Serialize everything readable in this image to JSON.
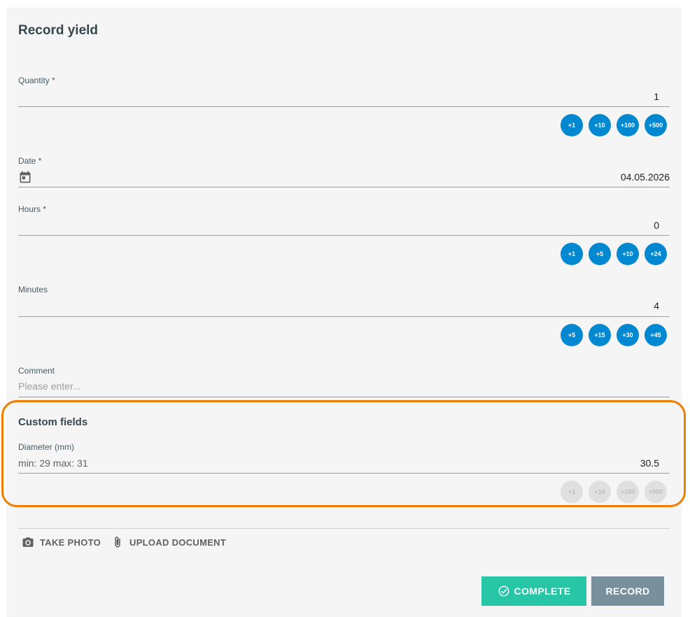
{
  "title": "Record yield",
  "quantity": {
    "label": "Quantity *",
    "value": "1",
    "buttons": [
      "+1",
      "+10",
      "+100",
      "+500"
    ]
  },
  "date": {
    "label": "Date *",
    "value": "04.05.2026",
    "icon": "calendar-icon"
  },
  "hours": {
    "label": "Hours *",
    "value": "0",
    "buttons": [
      "+1",
      "+5",
      "+10",
      "+24"
    ]
  },
  "minutes": {
    "label": "Minutes",
    "value": "4",
    "buttons": [
      "+5",
      "+15",
      "+30",
      "+45"
    ]
  },
  "comment": {
    "label": "Comment",
    "placeholder": "Please enter..."
  },
  "custom_fields": {
    "title": "Custom fields",
    "diameter": {
      "label": "Diameter (mm)",
      "hint": "min: 29 max: 31",
      "value": "30.5",
      "buttons": [
        "+1",
        "+10",
        "+100",
        "+500"
      ]
    }
  },
  "actions": {
    "take_photo": "TAKE PHOTO",
    "upload_document": "UPLOAD DOCUMENT",
    "complete": "COMPLETE",
    "record": "RECORD"
  },
  "colors": {
    "primary": "#0288d1",
    "complete": "#26c6a6",
    "record": "#78909c",
    "highlight": "#ef7d00"
  }
}
